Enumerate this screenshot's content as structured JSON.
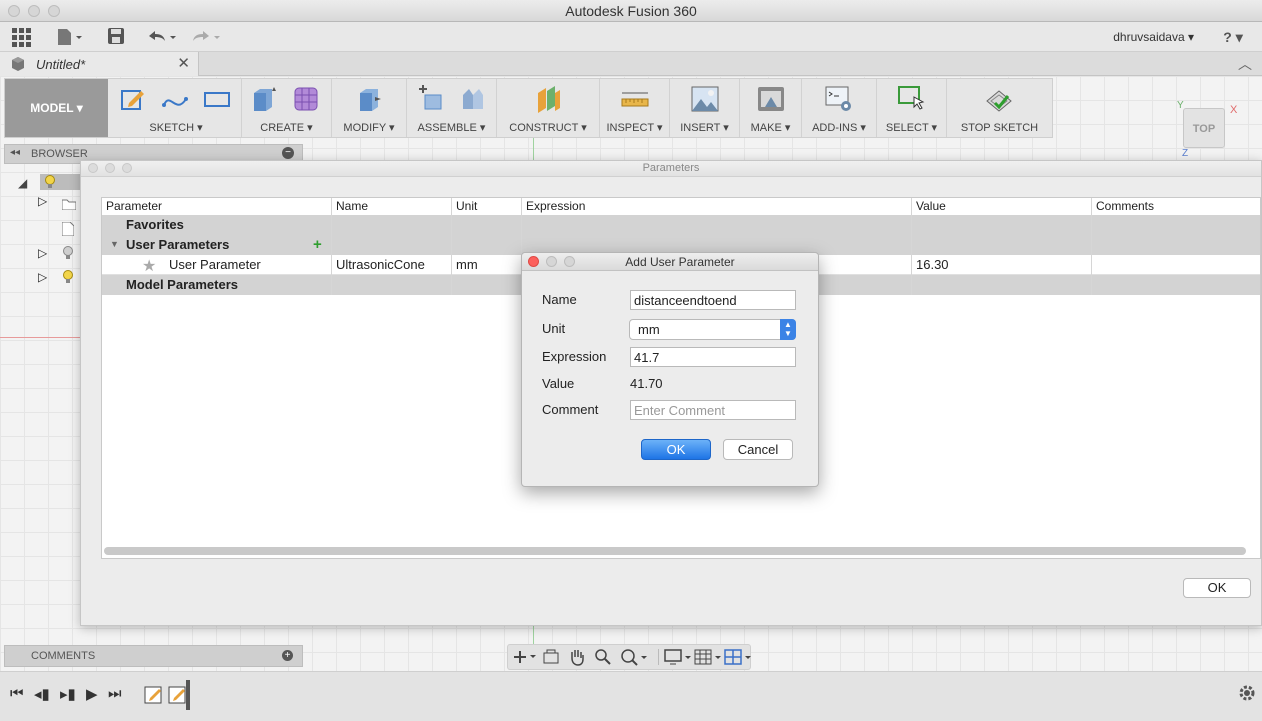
{
  "window": {
    "title": "Autodesk Fusion 360"
  },
  "quickbar": {
    "user": "dhruvsaidava ▾",
    "help": "? ▾"
  },
  "document_tab": {
    "label": "Untitled*"
  },
  "toolbar": {
    "workspace": "MODEL ▾",
    "groups": [
      {
        "label": "SKETCH ▾"
      },
      {
        "label": "CREATE ▾"
      },
      {
        "label": "MODIFY ▾"
      },
      {
        "label": "ASSEMBLE ▾"
      },
      {
        "label": "CONSTRUCT ▾"
      },
      {
        "label": "INSPECT ▾"
      },
      {
        "label": "INSERT ▾"
      },
      {
        "label": "MAKE ▾"
      },
      {
        "label": "ADD-INS ▾"
      },
      {
        "label": "SELECT ▾"
      },
      {
        "label": "STOP SKETCH"
      }
    ]
  },
  "viewcube": {
    "face": "TOP",
    "x_axis": "X",
    "y_axis": "Y",
    "z_axis": "Z"
  },
  "browser": {
    "title": "BROWSER"
  },
  "comments": {
    "title": "COMMENTS"
  },
  "parameters_dialog": {
    "title": "Parameters",
    "columns": [
      "Parameter",
      "Name",
      "Unit",
      "Expression",
      "Value",
      "Comments"
    ],
    "groups": {
      "favorites": "Favorites",
      "user": "User Parameters",
      "model": "Model Parameters"
    },
    "user_row": {
      "parameter": "User Parameter",
      "name": "UltrasonicCone",
      "unit": "mm",
      "value": "16.30"
    },
    "ok_label": "OK"
  },
  "add_param_dialog": {
    "title": "Add User Parameter",
    "name_label": "Name",
    "name_value": "distanceendtoend",
    "unit_label": "Unit",
    "unit_value": "mm",
    "expression_label": "Expression",
    "expression_value": "41.7",
    "value_label": "Value",
    "value_value": "41.70",
    "comment_label": "Comment",
    "comment_placeholder": "Enter Comment",
    "ok_label": "OK",
    "cancel_label": "Cancel"
  },
  "colors": {
    "accent": "#1e74e6",
    "close_red": "#fc605c",
    "plus_green": "#2e9e2e"
  }
}
